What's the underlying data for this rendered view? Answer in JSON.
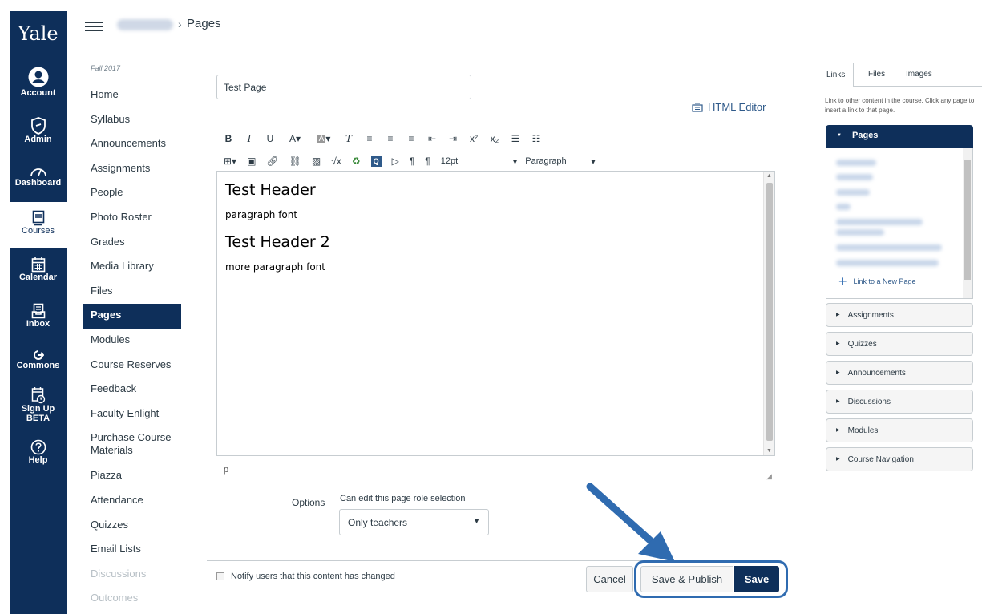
{
  "global_nav": {
    "logo": "Yale",
    "items": [
      {
        "label": "Account",
        "icon": "account-icon"
      },
      {
        "label": "Admin",
        "icon": "admin-icon"
      },
      {
        "label": "Dashboard",
        "icon": "dashboard-icon"
      },
      {
        "label": "Courses",
        "icon": "courses-icon"
      },
      {
        "label": "Calendar",
        "icon": "calendar-icon"
      },
      {
        "label": "Inbox",
        "icon": "inbox-icon"
      },
      {
        "label": "Commons",
        "icon": "commons-icon"
      },
      {
        "label": "Sign Up",
        "label2": "BETA",
        "icon": "signup-icon"
      },
      {
        "label": "Help",
        "icon": "help-icon"
      }
    ]
  },
  "breadcrumb": {
    "separator": "›",
    "current": "Pages"
  },
  "course_nav": {
    "term": "Fall 2017",
    "links": [
      "Home",
      "Syllabus",
      "Announcements",
      "Assignments",
      "People",
      "Photo Roster",
      "Grades",
      "Media Library",
      "Files",
      "Pages",
      "Modules",
      "Course Reserves",
      "Feedback",
      "Faculty Enlight",
      "Purchase Course Materials",
      "Piazza",
      "Attendance",
      "Quizzes",
      "Email Lists",
      "Discussions",
      "Outcomes"
    ],
    "active": "Pages"
  },
  "editor": {
    "title_value": "Test Page",
    "html_editor_label": "HTML Editor",
    "font_size": "12pt",
    "block_format": "Paragraph",
    "content": {
      "header1": "Test Header",
      "para1": "paragraph font",
      "header2": "Test Header 2",
      "para2": "more paragraph font"
    },
    "path": "p"
  },
  "options": {
    "label": "Options",
    "description": "Can edit this page role selection",
    "selected": "Only teachers"
  },
  "footer": {
    "notify_label": "Notify users that this content has changed",
    "cancel": "Cancel",
    "save_publish": "Save & Publish",
    "save": "Save"
  },
  "right_sidebar": {
    "tabs": [
      "Links",
      "Files",
      "Images"
    ],
    "description": "Link to other content in the course. Click any page to insert a link to that page.",
    "pages_header": "Pages",
    "link_new": "Link to a New Page",
    "sections": [
      "Assignments",
      "Quizzes",
      "Announcements",
      "Discussions",
      "Modules",
      "Course Navigation"
    ]
  },
  "colors": {
    "brand": "#0e2f5a",
    "highlight": "#2f6bb0"
  }
}
